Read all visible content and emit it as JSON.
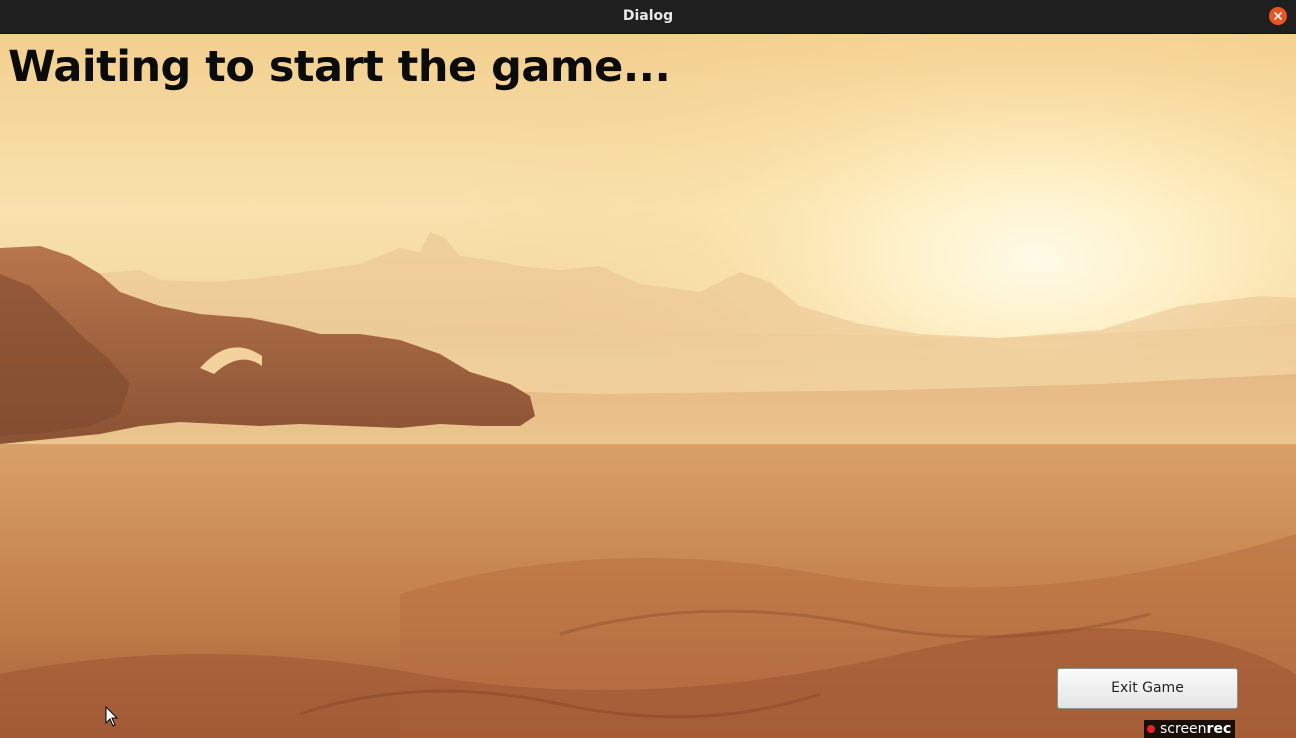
{
  "window": {
    "title": "Dialog",
    "close_icon": "close-icon",
    "close_color": "#e95420"
  },
  "main": {
    "heading": "Waiting to start the game...",
    "background": "desert-landscape-image"
  },
  "actions": {
    "exit_label": "Exit Game"
  },
  "watermark": {
    "part1": "screen",
    "part2": "rec"
  }
}
